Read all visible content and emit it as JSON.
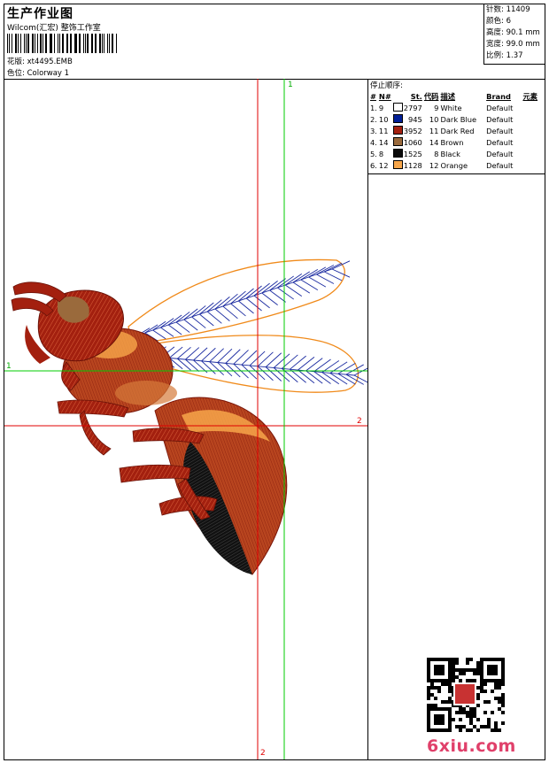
{
  "header": {
    "title": "生产作业图",
    "studio": "Wilcom(汇宏) 整饰工作室",
    "design_label": "花版:",
    "design_value": "xt4495.EMB",
    "colorway_label": "色位:",
    "colorway_value": "Colorway 1"
  },
  "stats": [
    {
      "label": "针数:",
      "value": "11409"
    },
    {
      "label": "颜色:",
      "value": "6"
    },
    {
      "label": "高度:",
      "value": "90.1 mm"
    },
    {
      "label": "宽度:",
      "value": "99.0 mm"
    },
    {
      "label": "比例:",
      "value": "1.37"
    }
  ],
  "threads": {
    "title": "停止顺序:",
    "headers": [
      "#",
      "N#",
      "St.",
      "代码",
      "描述",
      "Brand",
      "元素"
    ],
    "rows": [
      {
        "idx": "1.",
        "n": "9",
        "swatch": "#ffffff",
        "st": "2797",
        "code": "9",
        "desc": "White",
        "brand": "Default"
      },
      {
        "idx": "2.",
        "n": "10",
        "swatch": "#001e96",
        "st": "945",
        "code": "10",
        "desc": "Dark Blue",
        "brand": "Default"
      },
      {
        "idx": "3.",
        "n": "11",
        "swatch": "#a3200f",
        "st": "3952",
        "code": "11",
        "desc": "Dark Red",
        "brand": "Default"
      },
      {
        "idx": "4.",
        "n": "14",
        "swatch": "#9a6a3c",
        "st": "1060",
        "code": "14",
        "desc": "Brown",
        "brand": "Default"
      },
      {
        "idx": "5.",
        "n": "8",
        "swatch": "#0a0a0a",
        "st": "1525",
        "code": "8",
        "desc": "Black",
        "brand": "Default"
      },
      {
        "idx": "6.",
        "n": "12",
        "swatch": "#f7a64a",
        "st": "1128",
        "code": "12",
        "desc": "Orange",
        "brand": "Default"
      }
    ]
  },
  "axes": {
    "green_top": "1",
    "green_left": "1",
    "red_right": "2",
    "red_bottom": "2"
  },
  "watermark": "6xiu.com",
  "colors": {
    "red_axis": "#e00000",
    "green_axis": "#00cc00"
  }
}
